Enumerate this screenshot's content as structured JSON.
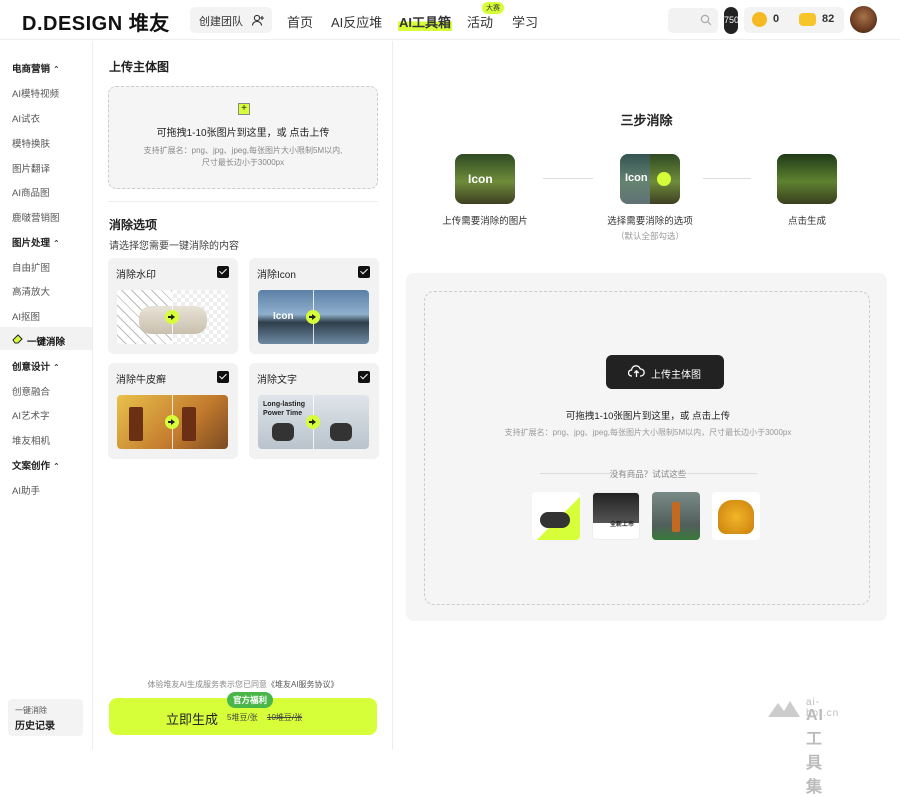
{
  "header": {
    "logo": "D.DESIGN 堆友",
    "team_button": "创建团队",
    "nav": [
      {
        "label": "首页"
      },
      {
        "label": "AI反应堆"
      },
      {
        "label": "AI工具箱",
        "active": true
      },
      {
        "label": "活动",
        "badge": "大赛"
      },
      {
        "label": "学习"
      }
    ],
    "pill_text": "750",
    "coin_count": "0",
    "bean_count": "82"
  },
  "sidebar": {
    "sections": [
      {
        "title": "电商营销",
        "items": [
          "AI模特视频",
          "AI试衣",
          "模特换肤",
          "图片翻译",
          "AI商品图",
          "鹿啵营销图"
        ]
      },
      {
        "title": "图片处理",
        "items": [
          "自由扩图",
          "高清放大",
          "AI抠图",
          "一键消除"
        ]
      },
      {
        "title": "创意设计",
        "items": [
          "创意融合",
          "AI艺术字",
          "堆友相机"
        ]
      },
      {
        "title": "文案创作",
        "items": [
          "AI助手"
        ]
      }
    ],
    "active_item": "一键消除",
    "history_sub": "一键消除",
    "history_main": "历史记录"
  },
  "panel": {
    "upload_title": "上传主体图",
    "upload_main": "可拖拽1-10张图片到这里，或 点击上传",
    "upload_hint_1": "支持扩展名：png、jpg、jpeg,每张图片大小限制5M以内,",
    "upload_hint_2": "尺寸最长边小于3000px",
    "options_title": "消除选项",
    "options_sub": "请选择您需要一键消除的内容",
    "options": [
      {
        "label": "消除水印",
        "checked": true
      },
      {
        "label": "消除Icon",
        "checked": true,
        "img_text": "Icon"
      },
      {
        "label": "消除牛皮癣",
        "checked": true
      },
      {
        "label": "消除文字",
        "checked": true,
        "img_text_1": "Long-lasting",
        "img_text_2": "Power Time"
      }
    ],
    "agreement_prefix": "体验堆友AI生成服务表示您已同意",
    "agreement_link": "《堆友AI服务协议》",
    "generate_label": "立即生成",
    "generate_price": "5堆豆/张",
    "generate_orig": "10堆豆/张",
    "generate_badge": "官方福利"
  },
  "steps": {
    "title": "三步消除",
    "items": [
      {
        "label": "上传需要消除的图片",
        "img_text": "Icon"
      },
      {
        "label": "选择需要消除的选项",
        "sub": "（默认全部勾选）",
        "img_text": "Icon"
      },
      {
        "label": "点击生成"
      }
    ]
  },
  "upload_card": {
    "button": "上传主体图",
    "main": "可拖拽1-10张图片到这里，或 点击上传",
    "hint": "支持扩展名：png、jpg、jpeg,每张图片大小限制5M以内，尺寸最长边小于3000px",
    "try_label": "没有商品？试试这些",
    "samples": [
      {
        "name": "gamepad"
      },
      {
        "name": "product-sale",
        "text": "全新上市"
      },
      {
        "name": "bottle"
      },
      {
        "name": "yellow-chair"
      }
    ]
  },
  "watermark": {
    "url": "ai-bot.cn",
    "name": "AI工具集"
  },
  "colors": {
    "accent": "#d6ff3a",
    "badge_green": "#4ab64a",
    "dark": "#222222"
  }
}
